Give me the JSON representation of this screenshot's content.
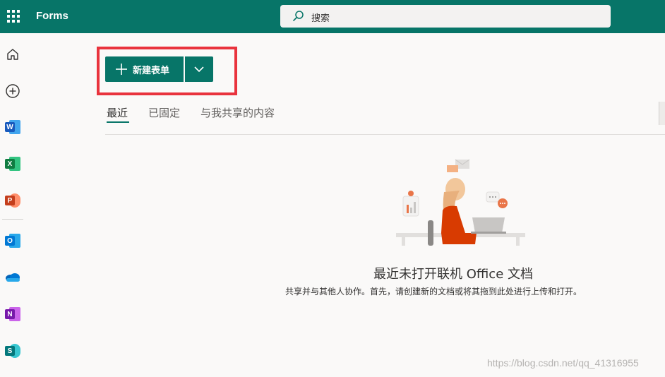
{
  "header": {
    "app_title": "Forms",
    "search_placeholder": "搜索",
    "brand_color": "#077568"
  },
  "rail": {
    "items": [
      {
        "name": "home",
        "icon": "home-icon"
      },
      {
        "name": "create",
        "icon": "plus-circle-icon"
      },
      {
        "name": "word",
        "icon": "word-icon",
        "letter": "W",
        "color": "#185abd"
      },
      {
        "name": "excel",
        "icon": "excel-icon",
        "letter": "X",
        "color": "#107c41"
      },
      {
        "name": "powerpoint",
        "icon": "powerpoint-icon",
        "letter": "P",
        "color": "#c43e1c"
      },
      {
        "name": "outlook",
        "icon": "outlook-icon",
        "letter": "O",
        "color": "#0078d4"
      },
      {
        "name": "onedrive",
        "icon": "onedrive-icon"
      },
      {
        "name": "onenote",
        "icon": "onenote-icon",
        "letter": "N",
        "color": "#7719aa"
      },
      {
        "name": "sharepoint",
        "icon": "sharepoint-icon",
        "letter": "S",
        "color": "#03787c"
      }
    ]
  },
  "toolbar": {
    "new_form_label": "新建表单",
    "highlight_color": "#e9333d"
  },
  "tabs": [
    {
      "label": "最近",
      "active": true
    },
    {
      "label": "已固定",
      "active": false
    },
    {
      "label": "与我共享的内容",
      "active": false
    }
  ],
  "empty_state": {
    "title": "最近未打开联机 Office 文档",
    "subtitle": "共享并与其他人协作。首先，请创建新的文档或将其拖到此处进行上传和打开。"
  },
  "watermark": "https://blog.csdn.net/qq_41316955"
}
